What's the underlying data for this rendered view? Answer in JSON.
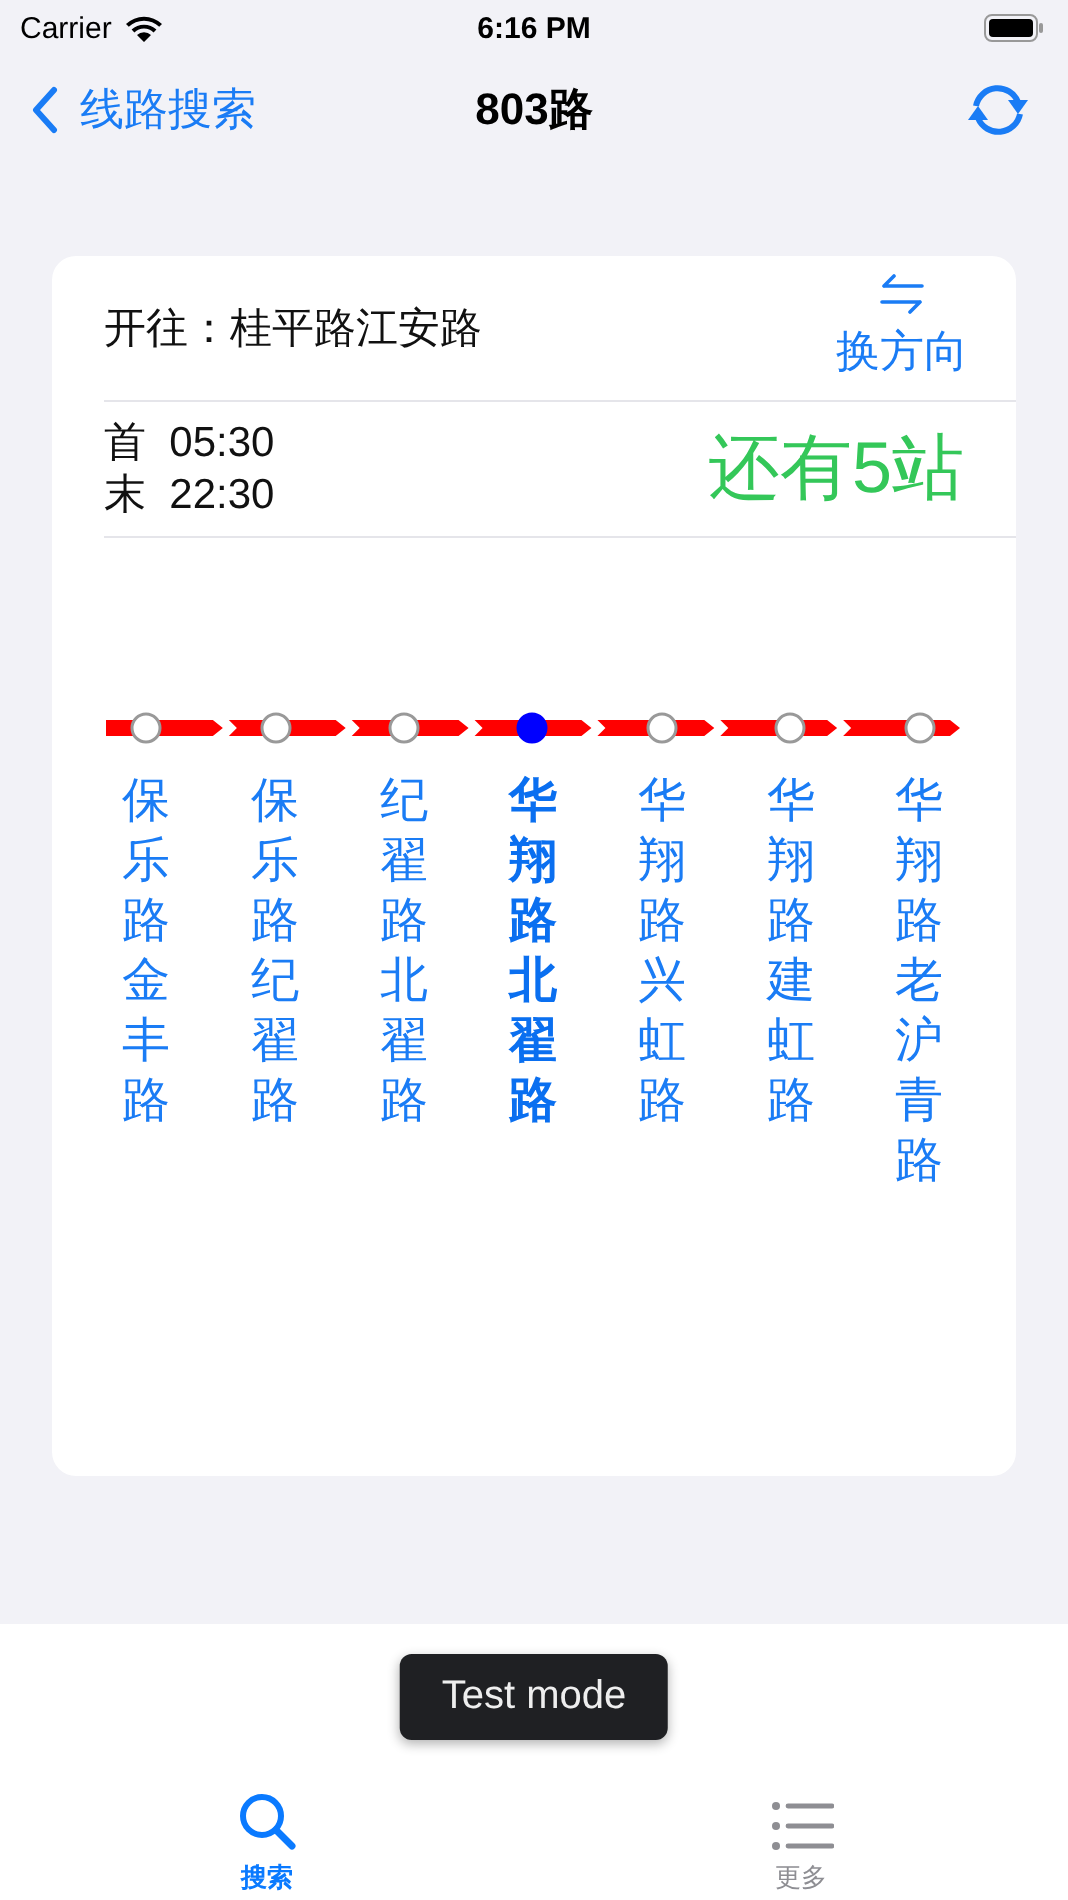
{
  "status_bar": {
    "carrier": "Carrier",
    "time": "6:16 PM"
  },
  "nav": {
    "back_label": "线路搜索",
    "title": "803路"
  },
  "card": {
    "direction_label": "开往：桂平路江安路",
    "switch_label": "换方向",
    "first_bus": {
      "label": "首",
      "time": "05:30"
    },
    "last_bus": {
      "label": "末",
      "time": "22:30"
    },
    "remaining": "还有5站",
    "stations": [
      {
        "name": "保乐路金丰路",
        "selected": false
      },
      {
        "name": "保乐路纪翟路",
        "selected": false
      },
      {
        "name": "纪翟路北翟路",
        "selected": false
      },
      {
        "name": "华翔路北翟路",
        "selected": true
      },
      {
        "name": "华翔路兴虹路",
        "selected": false
      },
      {
        "name": "华翔路建虹路",
        "selected": false
      },
      {
        "name": "华翔路老沪青路",
        "selected": false
      }
    ]
  },
  "toast": "Test mode",
  "tabs": [
    {
      "label": "搜索",
      "kind": "search",
      "selected": true
    },
    {
      "label": "更多",
      "kind": "list",
      "selected": false
    }
  ]
}
